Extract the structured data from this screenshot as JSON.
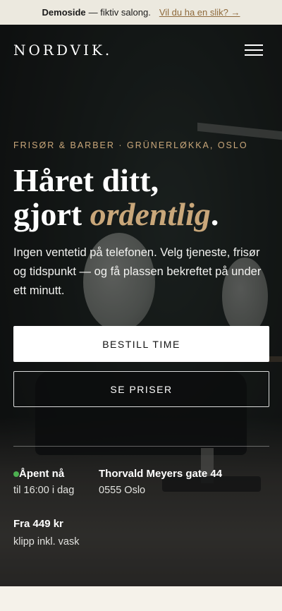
{
  "demo_banner": {
    "brand": "Demoside",
    "text": " — fiktiv salong.",
    "link": "Vil du ha en slik? →"
  },
  "header": {
    "logo": "NORDVIK.",
    "menu_icon": "hamburger-menu-icon"
  },
  "hero": {
    "eyebrow": "FRISØR & BARBER · GRÜNERLØKKA, OSLO",
    "headline_line1": "Håret ditt,",
    "headline_line2_prefix": "gjort ",
    "headline_accent": "ordentlig",
    "headline_suffix": ".",
    "lead": "Ingen ventetid på telefonen. Velg tjeneste, frisør og tidspunkt — og få plassen bekreftet på under ett minutt.",
    "primary_button": "BESTILL TIME",
    "secondary_button": "SE PRISER"
  },
  "info": {
    "status_title": "Åpent nå",
    "status_sub": "til 16:00 i dag",
    "address_title": "Thorvald Meyers gate 44",
    "address_sub": "0555 Oslo",
    "price_title": "Fra 449 kr",
    "price_sub": "klipp inkl. vask"
  },
  "colors": {
    "accent": "#c9a77a",
    "status_open": "#4caf50",
    "banner_bg": "#ece9df"
  }
}
